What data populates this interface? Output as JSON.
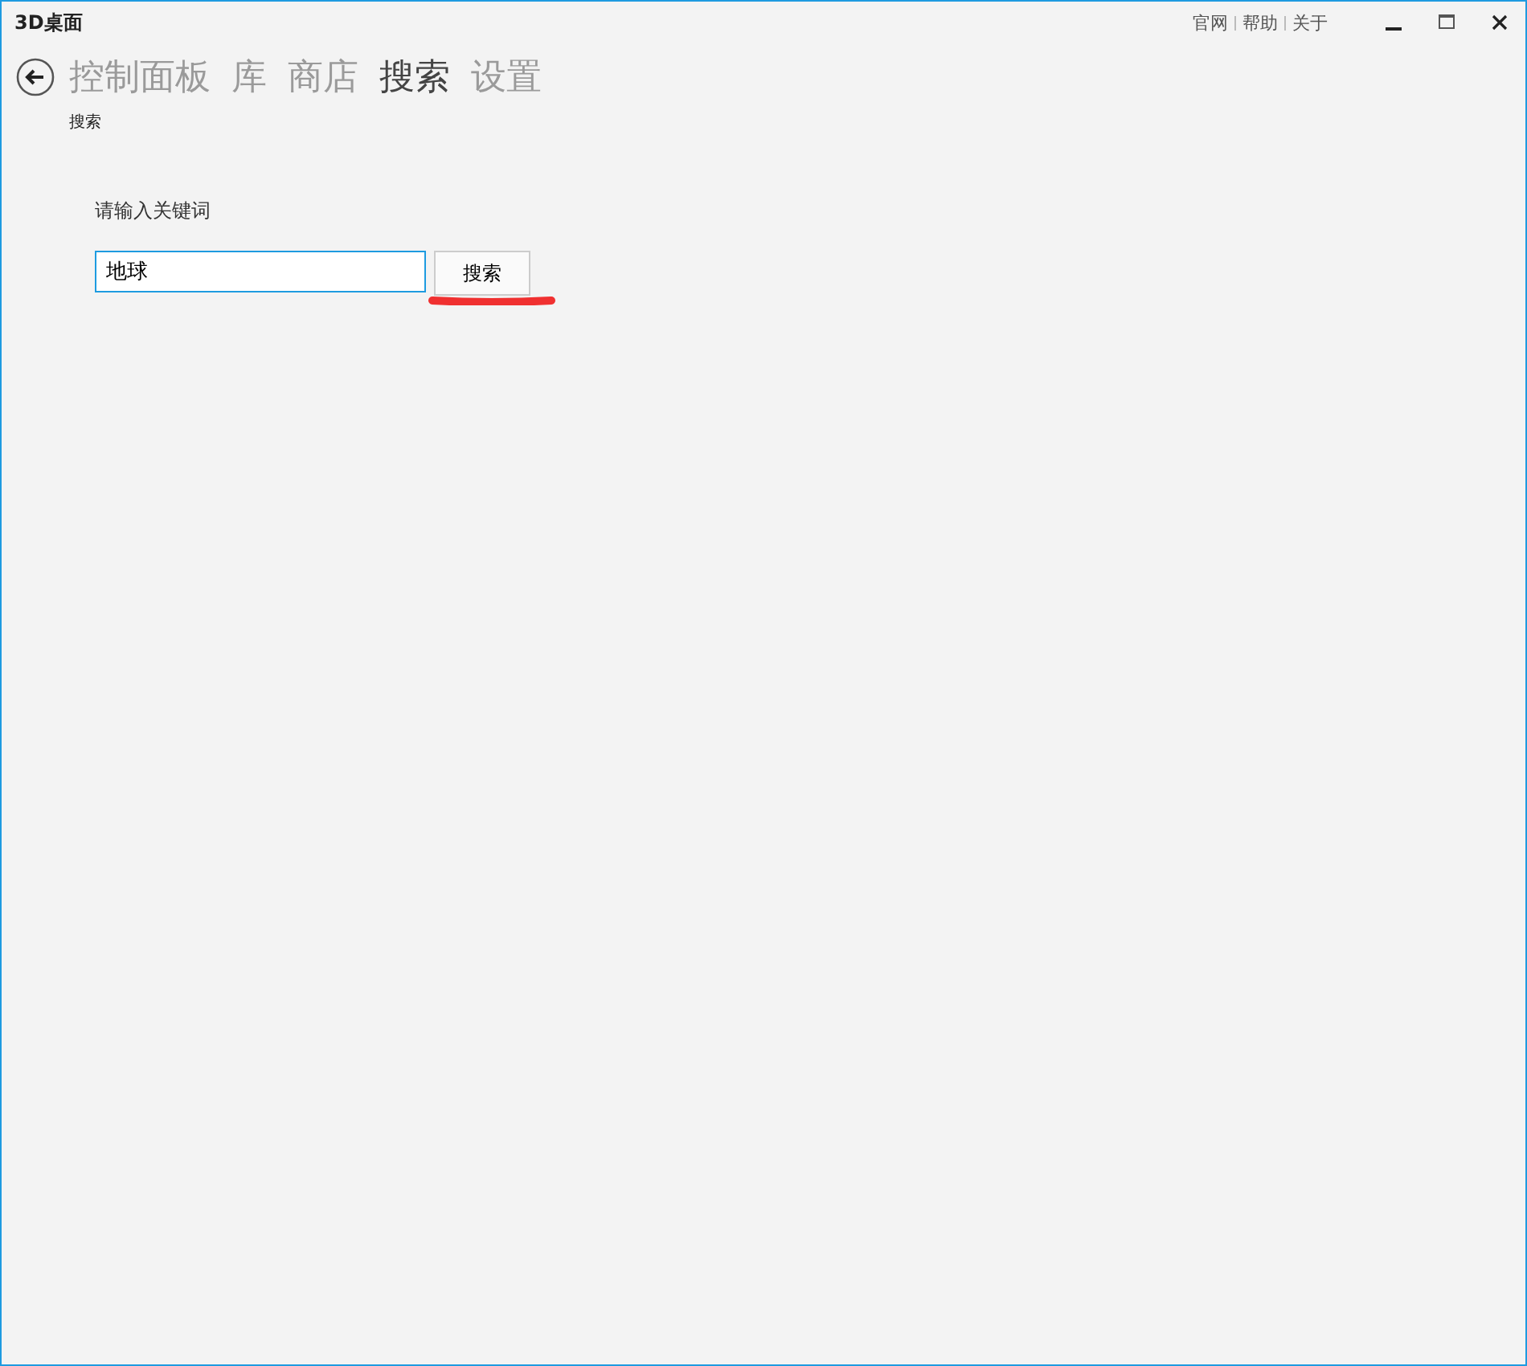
{
  "window": {
    "title": "3D桌面",
    "links": [
      "官网",
      "帮助",
      "关于"
    ]
  },
  "nav": {
    "items": [
      {
        "label": "控制面板",
        "selected": false
      },
      {
        "label": "库",
        "selected": false
      },
      {
        "label": "商店",
        "selected": false
      },
      {
        "label": "搜索",
        "selected": true
      },
      {
        "label": "设置",
        "selected": false
      }
    ],
    "subtitle": "搜索"
  },
  "search": {
    "label": "请输入关键词",
    "value": "地球",
    "button": "搜索"
  }
}
